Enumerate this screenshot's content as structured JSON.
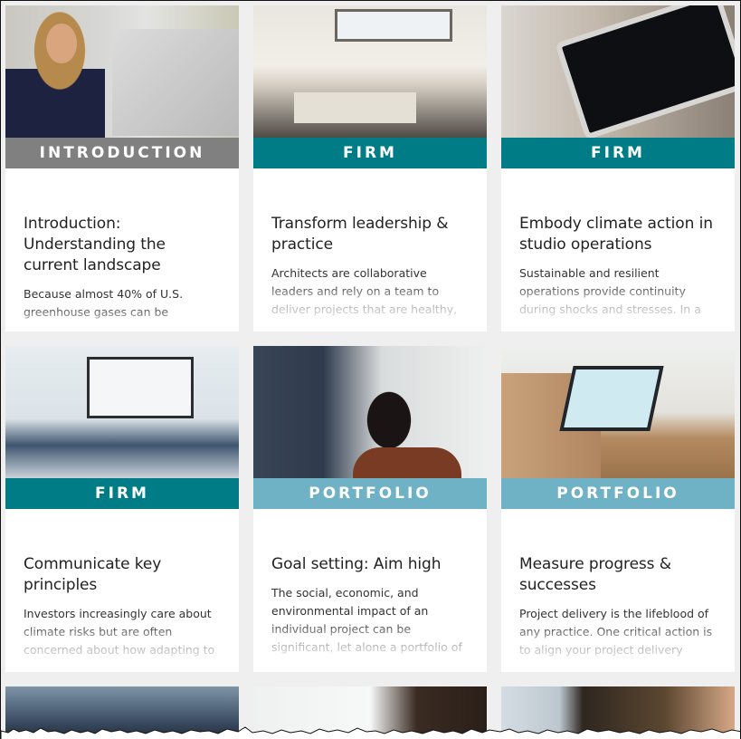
{
  "colors": {
    "page_background": "#efefef",
    "tag_introduction": "#808080",
    "tag_firm": "#007c87",
    "tag_portfolio": "#6fb2c6"
  },
  "cards": [
    {
      "image": "woman-at-computer-photo",
      "tag": "INTRODUCTION",
      "tag_type": "introduction",
      "title": "Introduction: Understanding the current landscape",
      "description": "Because almost 40% of U.S. greenhouse gases can be"
    },
    {
      "image": "team-meeting-photo",
      "tag": "FIRM",
      "tag_type": "firm",
      "title": "Transform leadership & practice",
      "description": "Architects are collaborative leaders and rely on a team to deliver projects that are healthy,"
    },
    {
      "image": "tablet-dashboard-photo",
      "tag": "FIRM",
      "tag_type": "firm",
      "title": "Embody climate action in studio operations",
      "description": "Sustainable and resilient operations provide continuity during shocks and stresses. In a"
    },
    {
      "image": "presentation-meeting-photo",
      "tag": "FIRM",
      "tag_type": "firm",
      "title": "Communicate key principles",
      "description": "Investors increasingly care about climate risks but are often concerned about how adapting to"
    },
    {
      "image": "whiteboard-photo",
      "tag": "PORTFOLIO",
      "tag_type": "portfolio",
      "title": "Goal setting: Aim high",
      "description": "The social, economic, and environmental impact of an individual project can be significant, let alone a portfolio of"
    },
    {
      "image": "architecture-model-tablet-photo",
      "tag": "PORTFOLIO",
      "tag_type": "portfolio",
      "title": "Measure progress & successes",
      "description": "Project delivery is the lifeblood of any practice. One critical action is to align your project delivery"
    }
  ],
  "partial_cards": [
    {
      "image": "woman-with-laptop-photo"
    },
    {
      "image": "office-group-photo"
    },
    {
      "image": "man-with-solar-panels-photo"
    }
  ]
}
